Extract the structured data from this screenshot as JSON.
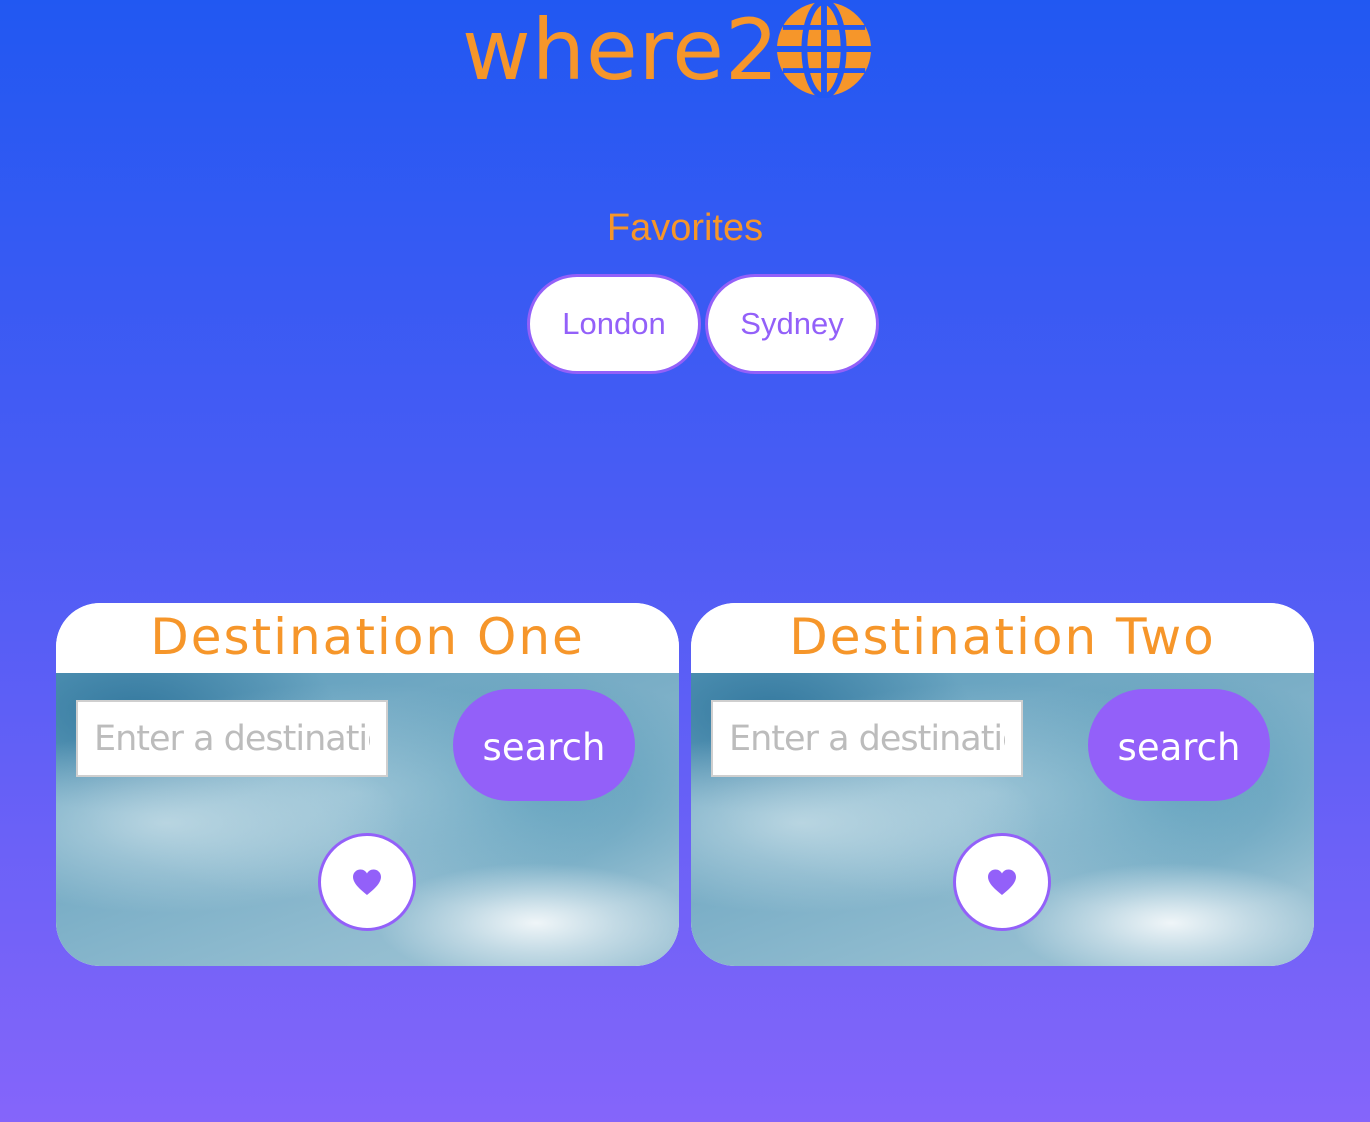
{
  "app": {
    "logo_text": "where2",
    "logo_icon": "globe-icon",
    "brand_color": "#f6962a",
    "accent_color": "#9360f9"
  },
  "favorites": {
    "title": "Favorites",
    "items": [
      {
        "label": "London"
      },
      {
        "label": "Sydney"
      }
    ]
  },
  "destinations": [
    {
      "title": "Destination One",
      "input_placeholder": "Enter a destination",
      "input_value": "",
      "search_label": "search",
      "favorite_icon": "heart-icon"
    },
    {
      "title": "Destination Two",
      "input_placeholder": "Enter a destination",
      "input_value": "",
      "search_label": "search",
      "favorite_icon": "heart-icon"
    }
  ]
}
